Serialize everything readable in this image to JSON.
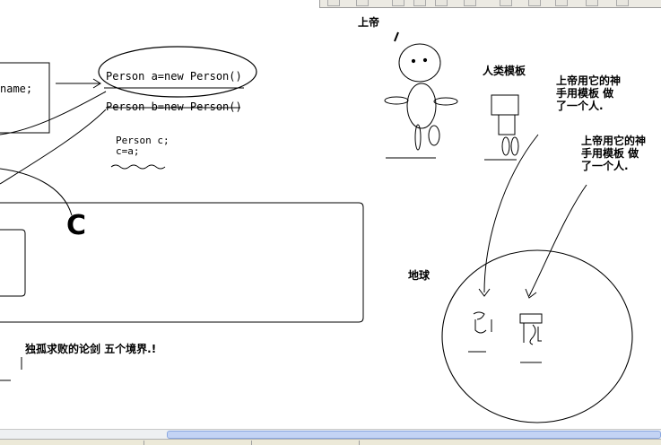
{
  "whiteboard": {
    "class_field_fragment": "name;",
    "code_line_a": "Person a=new Person()",
    "code_line_b": "Person b=new Person()",
    "code_line_c": "Person c;",
    "code_line_c_assign": "c=a;",
    "big_letter_c": "C",
    "god_label": "上帝",
    "human_template_label": "人类模板",
    "note_first_lines": [
      "上帝用它的神",
      "手用模板 做",
      "了一个人."
    ],
    "note_second_lines": [
      "上帝用它的神",
      "手用模板 做",
      "了一个人."
    ],
    "earth_label": "地球",
    "bottom_text": "独孤求败的论剑 五个境界.!"
  },
  "ui": {
    "scroll_position_pct": 25
  }
}
